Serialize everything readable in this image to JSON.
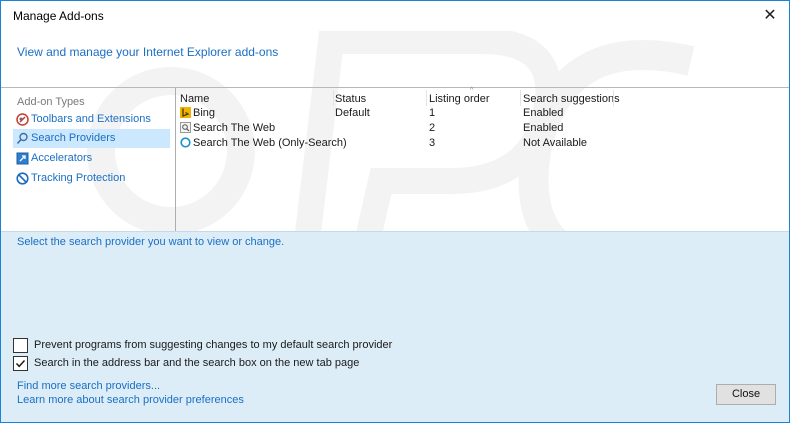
{
  "window": {
    "title": "Manage Add-ons",
    "close_glyph": "✕"
  },
  "header": {
    "link": "View and manage your Internet Explorer add-ons"
  },
  "sidebar": {
    "heading": "Add-on Types",
    "items": [
      {
        "label": "Toolbars and Extensions",
        "icon": "toolbars-extensions-icon"
      },
      {
        "label": "Search Providers",
        "icon": "search-providers-icon",
        "selected": true
      },
      {
        "label": "Accelerators",
        "icon": "accelerators-icon"
      },
      {
        "label": "Tracking Protection",
        "icon": "tracking-protection-icon"
      }
    ]
  },
  "list": {
    "columns": [
      "Name",
      "Status",
      "Listing order",
      "Search suggestions"
    ],
    "rows": [
      {
        "name": "Bing",
        "status": "Default",
        "order": "1",
        "suggestions": "Enabled",
        "icon": "bing-icon"
      },
      {
        "name": "Search The Web",
        "status": "",
        "order": "2",
        "suggestions": "Enabled",
        "icon": "web-search-icon"
      },
      {
        "name": "Search The Web (Only-Search)",
        "status": "",
        "order": "3",
        "suggestions": "Not Available",
        "icon": "only-search-icon"
      }
    ]
  },
  "details": {
    "hint": "Select the search provider you want to view or change.",
    "checkboxes": [
      {
        "label": "Prevent programs from suggesting changes to my default search provider",
        "checked": false
      },
      {
        "label": "Search in the address bar and the search box on the new tab page",
        "checked": true
      }
    ]
  },
  "footer": {
    "links": [
      "Find more search providers...",
      "Learn more about search provider preferences"
    ],
    "close_label": "Close"
  },
  "colors": {
    "accent": "#1a6fc4",
    "selection": "#cce8ff",
    "border": "#1883d7",
    "panel": "#dcedf8"
  }
}
